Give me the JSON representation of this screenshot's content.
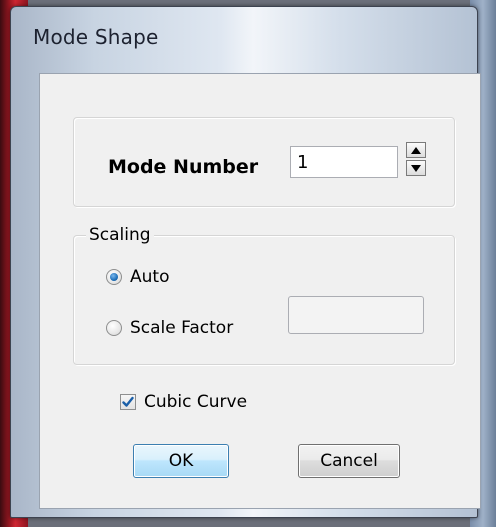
{
  "window": {
    "title": "Mode Shape"
  },
  "mode": {
    "label": "Mode Number",
    "value": "1",
    "spin_up_icon": "triangle-up-icon",
    "spin_down_icon": "triangle-down-icon"
  },
  "scaling": {
    "group_label": "Scaling",
    "options": [
      {
        "label": "Auto",
        "checked": true
      },
      {
        "label": "Scale Factor",
        "checked": false
      }
    ],
    "scale_factor_value": ""
  },
  "cubic_curve": {
    "label": "Cubic Curve",
    "checked": true
  },
  "buttons": {
    "ok": "OK",
    "cancel": "Cancel"
  },
  "colors": {
    "ok_border": "#3c7fb1",
    "radio_selected": "#1f6fb8",
    "checkmark": "#1b5fa8"
  }
}
